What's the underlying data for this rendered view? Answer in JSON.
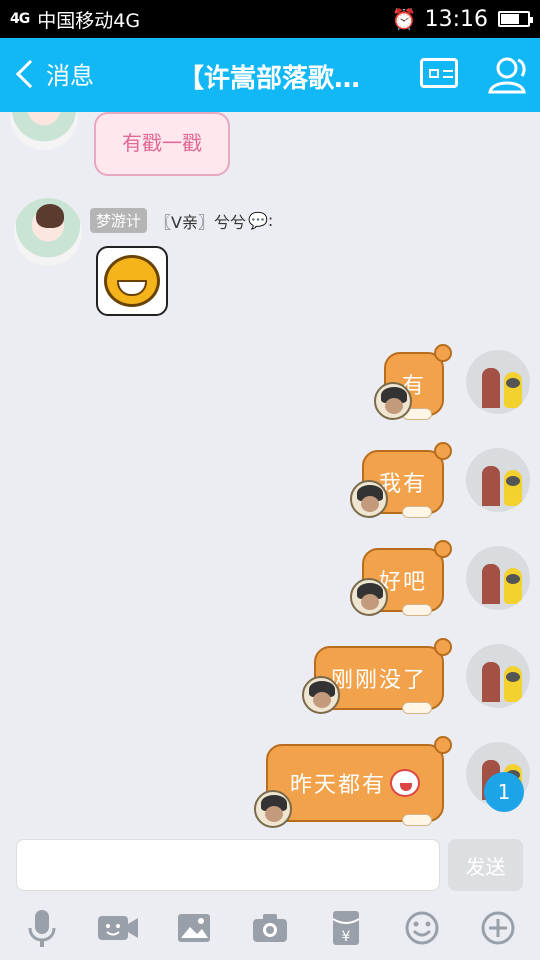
{
  "status_bar": {
    "signal": "4G",
    "carrier": "中国移动4G",
    "time": "13:16",
    "battery_level": 0.7
  },
  "title_bar": {
    "back_label": "消息",
    "chat_title": "【许嵩部落歌…"
  },
  "messages": [
    {
      "side": "left",
      "type": "sticker-text",
      "text": "有戳一戳"
    },
    {
      "side": "left",
      "type": "emoji",
      "badge": "梦游计",
      "sender": "〖V亲〗兮兮",
      "sender_suffix": ":"
    },
    {
      "side": "right",
      "type": "text",
      "text": "有"
    },
    {
      "side": "right",
      "type": "text",
      "text": "我有"
    },
    {
      "side": "right",
      "type": "text",
      "text": "好吧"
    },
    {
      "side": "right",
      "type": "text",
      "text": "刚刚没了"
    },
    {
      "side": "right",
      "type": "text",
      "text": "昨天都有"
    }
  ],
  "unread_count": "1",
  "input": {
    "value": "",
    "placeholder": ""
  },
  "send_label": "发送",
  "toolbar_icons": [
    "microphone-icon",
    "video-icon",
    "image-icon",
    "camera-icon",
    "red-packet-icon",
    "emoji-icon",
    "plus-icon"
  ],
  "colors": {
    "header": "#12b7f5",
    "bubble_orange": "#f1a24a",
    "background": "#ebedf2"
  }
}
